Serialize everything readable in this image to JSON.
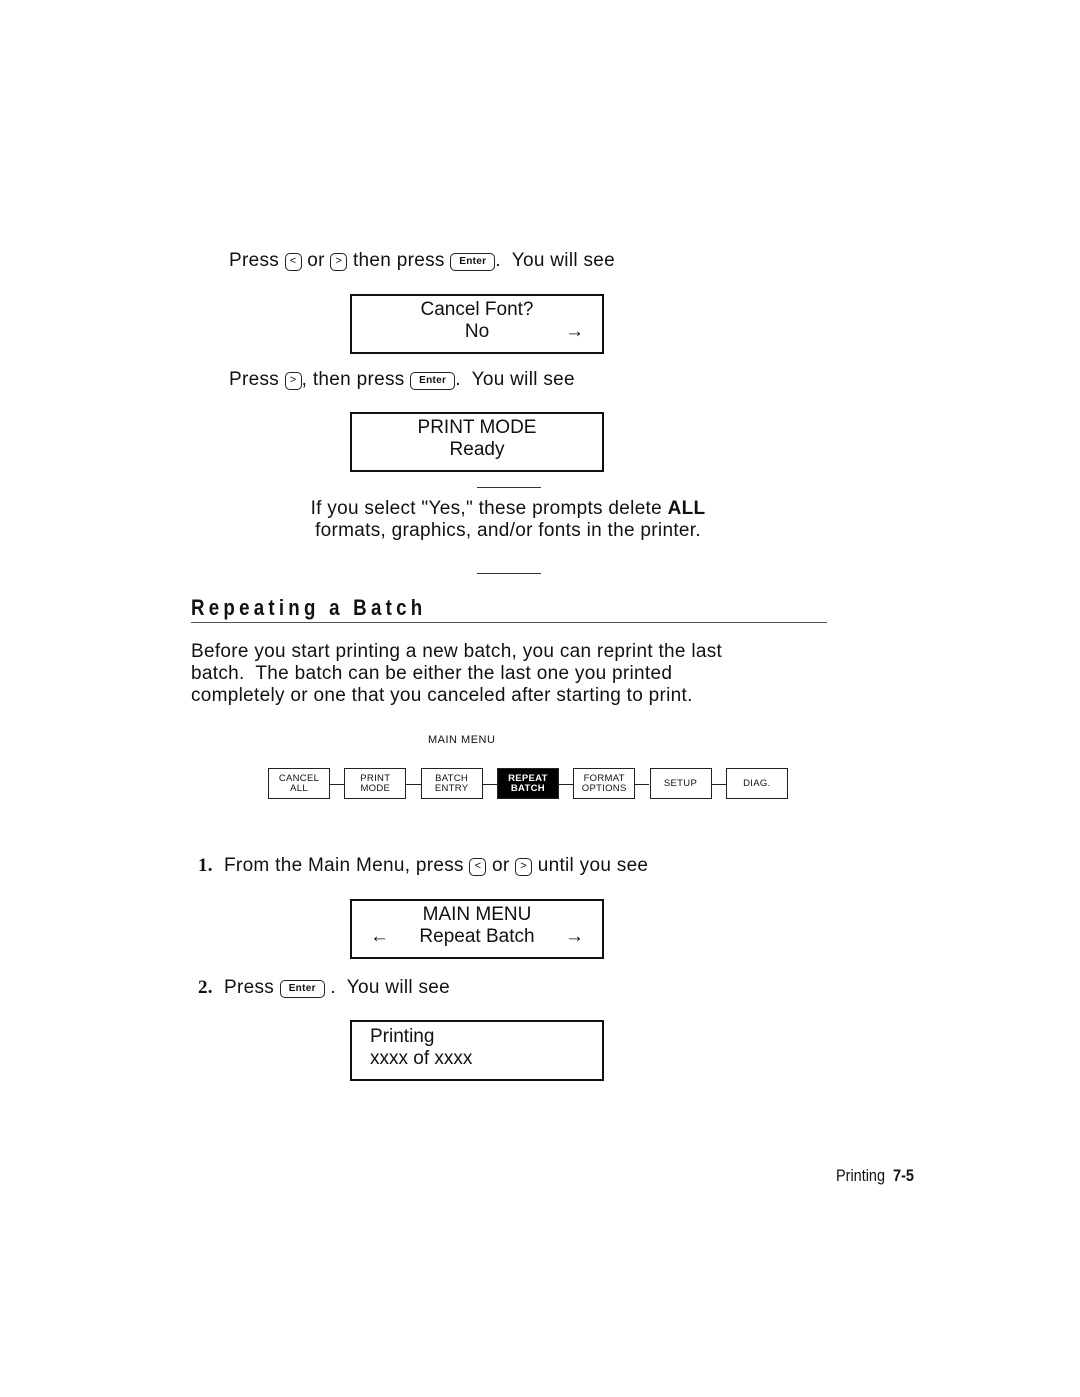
{
  "step_a": {
    "press": "Press",
    "key_left": "<",
    "or": "or",
    "key_right": ">",
    "then_press": "then press",
    "key_enter": "Enter",
    "suffix": ".  You will see"
  },
  "display_cancel_font": {
    "line1": "Cancel Font?",
    "line2": "No",
    "arrow_right": "→"
  },
  "step_b": {
    "press": "Press",
    "key_right": ">",
    "then_press": ", then press",
    "key_enter": "Enter",
    "suffix": ".  You will see"
  },
  "display_print_mode": {
    "line1": "PRINT MODE",
    "line2": "Ready"
  },
  "warning": {
    "text_before": "If you select \"Yes,\" these prompts delete ",
    "bold": "ALL",
    "line2": "formats, graphics, and/or fonts in the printer."
  },
  "section": {
    "heading": "Repeating a Batch",
    "intro_line1": "Before you start printing a new batch, you can reprint the last",
    "intro_line2": "batch.  The batch can be either the last one you printed",
    "intro_line3": "completely or one that you canceled after starting to print."
  },
  "menu_diagram": {
    "title": "MAIN MENU",
    "items": [
      {
        "line1": "CANCEL",
        "line2": "ALL",
        "active": false
      },
      {
        "line1": "PRINT",
        "line2": "MODE",
        "active": false
      },
      {
        "line1": "BATCH",
        "line2": "ENTRY",
        "active": false
      },
      {
        "line1": "REPEAT",
        "line2": "BATCH",
        "active": true
      },
      {
        "line1": "FORMAT",
        "line2": "OPTIONS",
        "active": false
      },
      {
        "line1": "SETUP",
        "line2": "",
        "active": false
      },
      {
        "line1": "DIAG.",
        "line2": "",
        "active": false
      }
    ]
  },
  "steps": [
    {
      "number": "1.",
      "text": "From the Main Menu, press",
      "key_left": "<",
      "or": "or",
      "key_right": ">",
      "suffix": "until you see"
    },
    {
      "number": "2.",
      "text": "Press",
      "key_enter": "Enter",
      "suffix": ".  You will see"
    }
  ],
  "display_main_menu": {
    "line1": "MAIN MENU",
    "line2": "Repeat Batch",
    "arrow_left": "←",
    "arrow_right": "→"
  },
  "display_printing": {
    "line1": "Printing",
    "line2": "xxxx of xxxx"
  },
  "footer": {
    "section": "Printing",
    "page": "7-5"
  }
}
